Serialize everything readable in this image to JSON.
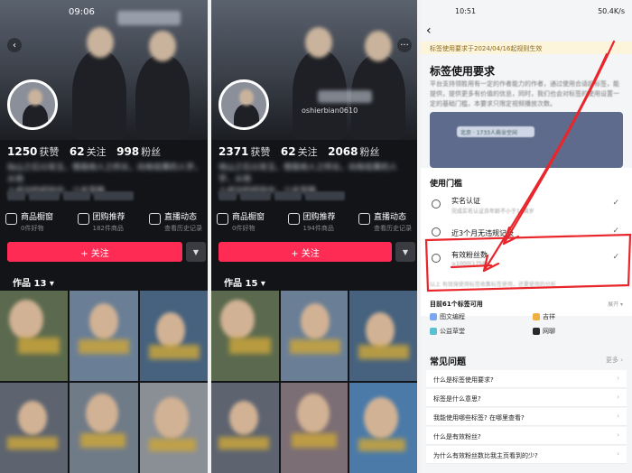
{
  "left": {
    "status_time": "09:06",
    "stats": [
      {
        "num": "1250",
        "label": "获赞"
      },
      {
        "num": "62",
        "label": "关注"
      },
      {
        "num": "998",
        "label": "粉丝"
      }
    ],
    "bio_line1": "灿山之石以攻玉，借我他人之所长，向有结果的人学，从他",
    "bio_line2": "人成功的经验中，少走弯路",
    "shortcuts": [
      {
        "title": "商品橱窗",
        "sub": "0件好物"
      },
      {
        "title": "团购推荐",
        "sub": "182件商品"
      },
      {
        "title": "直播动态",
        "sub": "查看历史记录"
      }
    ],
    "follow_label": "+ 关注",
    "works_label": "作品 13 ▾"
  },
  "middle": {
    "handle": "oshierbian0610",
    "stats": [
      {
        "num": "2371",
        "label": "获赞"
      },
      {
        "num": "62",
        "label": "关注"
      },
      {
        "num": "2068",
        "label": "粉丝"
      }
    ],
    "bio_line1": "他山之石以攻玉，借我他人之所长，向有结果的人学，从他",
    "bio_line2": "人成功的经验中，少走弯路",
    "shortcuts": [
      {
        "title": "商品橱窗",
        "sub": "0件好物"
      },
      {
        "title": "团购推荐",
        "sub": "194件商品"
      },
      {
        "title": "直播动态",
        "sub": "查看历史记录"
      }
    ],
    "follow_label": "+ 关注",
    "works_label": "作品 15 ▾"
  },
  "right": {
    "status_time": "10:51",
    "status_right": "50.4K/s",
    "notice": "标签使用要求于2024/04/16起规则生效",
    "title": "标签使用要求",
    "desc": "平台支持领胜用有一定的作者能力的作者，通过使用合适的标签，能提供，提供更多有价值的信息，同时，我们也会对标签的使用设置一定的基础门槛，本要求只限定视频播放次数。",
    "screen_pill": "北京 · 1733人商业空间",
    "threshold_title": "使用门槛",
    "rows": [
      {
        "title": "实名认证",
        "sub": "完成实名认证且年龄不小于18周岁",
        "check": "✓"
      },
      {
        "title": "近3个月无违规记录",
        "sub": "",
        "check": "✓"
      },
      {
        "title": "有效粉丝数",
        "sub": "≥1000(1758)",
        "check": "✓"
      }
    ],
    "rows_note": "以上 有效保使用标签收集标签使用，还要使用的分析",
    "tags_title": "目前61个标签可用",
    "tags_more": "展开 ▾",
    "tag_items": [
      {
        "label": "图文编程",
        "color": "#7aa7f0"
      },
      {
        "label": "吉祥",
        "color": "#f0b040"
      },
      {
        "label": "公益草堂",
        "color": "#5ac0d0"
      },
      {
        "label": "网聊",
        "color": "#2a2a2a"
      }
    ],
    "faq_title": "常见问题",
    "faq_more": "更多 ›",
    "faqs": [
      "什么是标签使用要求?",
      "标签是什么意思?",
      "我能使用哪些标签? 在哪里查看?",
      "什么是有效粉丝?",
      "为什么有效粉丝数比我主页看到的少?"
    ],
    "annotation_color": "#e8262b"
  }
}
